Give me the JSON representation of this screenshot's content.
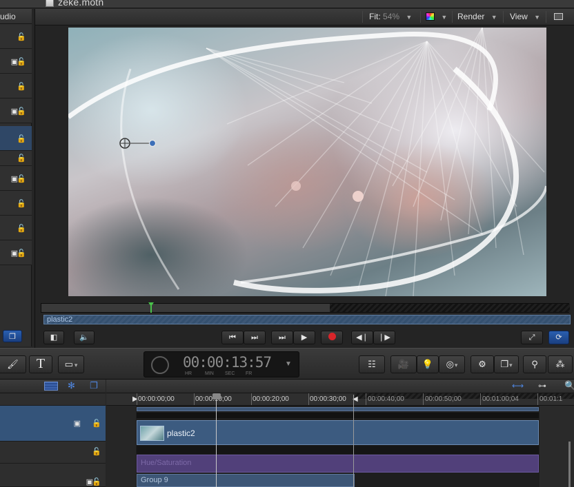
{
  "window": {
    "title": "zeke.motn"
  },
  "layers_panel": {
    "header": "udio",
    "rows": [
      {
        "icon": "lock-icon"
      },
      {
        "icon": "group-lock-icon"
      },
      {
        "icon": "lock-icon"
      },
      {
        "icon": "group-lock-icon"
      },
      {
        "icon": "lock-icon",
        "selected": true
      },
      {
        "icon": "lock-icon"
      },
      {
        "icon": "group-lock-icon"
      },
      {
        "icon": "lock-icon"
      },
      {
        "icon": "lock-icon"
      },
      {
        "icon": "group-lock-icon"
      }
    ]
  },
  "viewer": {
    "fit_label": "Fit:",
    "fit_value": "54%",
    "render_label": "Render",
    "view_label": "View",
    "clip_name": "plastic2",
    "accent": "#2a5fb0",
    "playhead_color": "#49c24a"
  },
  "toolbar": {
    "text_tool": "T",
    "timecode": "00:00:13:57",
    "timecode_units": [
      "HR",
      "MIN",
      "SEC",
      "FR"
    ]
  },
  "timeline": {
    "ruler_ticks": [
      {
        "label": "00:00:00;00"
      },
      {
        "label": "00:00:10;00"
      },
      {
        "label": "00:00:20;00"
      },
      {
        "label": "00:00:30;00"
      },
      {
        "label": "00:00:40;00"
      },
      {
        "label": "00:00:50;00"
      },
      {
        "label": "00:01:00;04"
      },
      {
        "label": "00:01:1"
      }
    ],
    "clips": {
      "plastic": "plastic2",
      "hue": "Hue/Saturation",
      "group": "Group 9"
    },
    "colors": {
      "video_clip": "#3c5b80",
      "filter_clip": "#51407a"
    }
  }
}
